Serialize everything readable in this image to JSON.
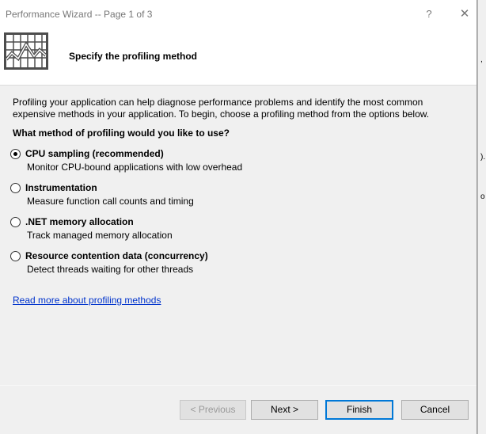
{
  "window": {
    "title": "Performance Wizard -- Page 1 of 3",
    "help_glyph": "?",
    "close_glyph": "✕"
  },
  "header": {
    "title": "Specify the profiling method",
    "icon": "performance-chart-icon"
  },
  "intro_text": "Profiling your application can help diagnose performance problems and identify the most common expensive methods in your application. To begin, choose a profiling method from the options below.",
  "question": "What method of profiling would you like to use?",
  "options": [
    {
      "label": "CPU sampling (recommended)",
      "description": "Monitor CPU-bound applications with low overhead",
      "selected": true
    },
    {
      "label": "Instrumentation",
      "description": "Measure function call counts and timing",
      "selected": false
    },
    {
      "label": ".NET memory allocation",
      "description": "Track managed memory allocation",
      "selected": false
    },
    {
      "label": "Resource contention data (concurrency)",
      "description": "Detect threads waiting for other threads",
      "selected": false
    }
  ],
  "link_text": "Read more about profiling methods",
  "buttons": {
    "previous": "< Previous",
    "next": "Next >",
    "finish": "Finish",
    "cancel": "Cancel"
  },
  "right_edge_fragments": [
    ",",
    ").",
    "o"
  ],
  "colors": {
    "accent": "#0078d7",
    "link": "#0033cc",
    "dialog_bg": "#f0f0f0"
  }
}
